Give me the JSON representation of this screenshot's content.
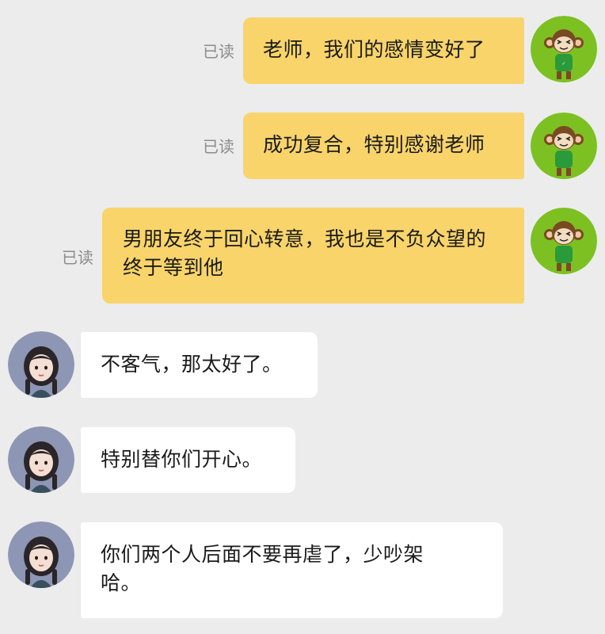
{
  "colors": {
    "background": "#ececec",
    "outgoing_bubble": "#f8d46a",
    "incoming_bubble": "#ffffff",
    "read_text": "#8c8c8c",
    "self_avatar_bg": "#7cc121"
  },
  "messages": [
    {
      "direction": "outgoing",
      "text": "老师，我们的感情变好了",
      "status": "已读",
      "avatar": "monkey-avatar-icon"
    },
    {
      "direction": "outgoing",
      "text": "成功复合，特别感谢老师",
      "status": "已读",
      "avatar": "monkey-avatar-icon"
    },
    {
      "direction": "outgoing",
      "text": "男朋友终于回心转意，我也是不负众望的终于等到他",
      "status": "已读",
      "avatar": "monkey-avatar-icon"
    },
    {
      "direction": "incoming",
      "text": "不客气，那太好了。",
      "avatar": "teacher-avatar-icon"
    },
    {
      "direction": "incoming",
      "text": "特别替你们开心。",
      "avatar": "teacher-avatar-icon"
    },
    {
      "direction": "incoming",
      "text": "你们两个人后面不要再虐了，少吵架哈。",
      "avatar": "teacher-avatar-icon"
    }
  ]
}
